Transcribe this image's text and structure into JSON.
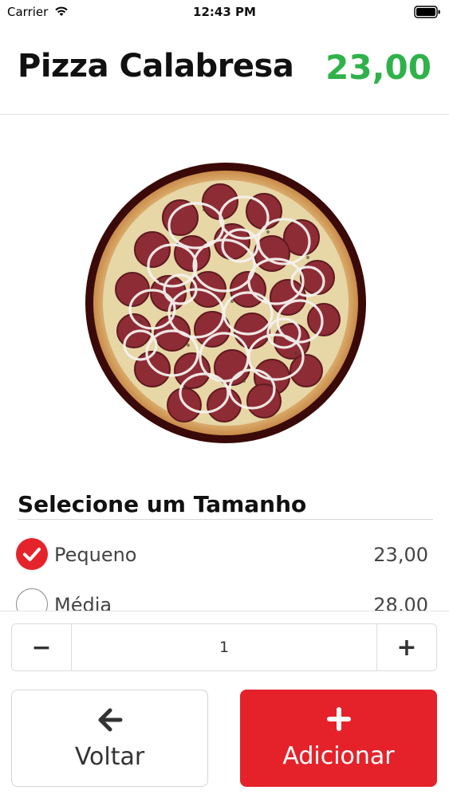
{
  "status_bar": {
    "carrier": "Carrier",
    "time": "12:43 PM"
  },
  "header": {
    "title": "Pizza Calabresa",
    "price": "23,00",
    "price_color": "#2fb24a"
  },
  "product_image": {
    "icon": "pizza-image"
  },
  "size_section": {
    "title": "Selecione um Tamanho",
    "options": [
      {
        "name": "Pequeno",
        "price": "23,00",
        "selected": true
      },
      {
        "name": "Média",
        "price": "28,00",
        "selected": false
      }
    ]
  },
  "quantity": {
    "minus_label": "−",
    "value": "1",
    "plus_label": "+"
  },
  "actions": {
    "back_label": "Voltar",
    "back_icon": "arrow-left-icon",
    "add_label": "Adicionar",
    "add_icon": "plus-icon",
    "accent_color": "#e5222a"
  }
}
